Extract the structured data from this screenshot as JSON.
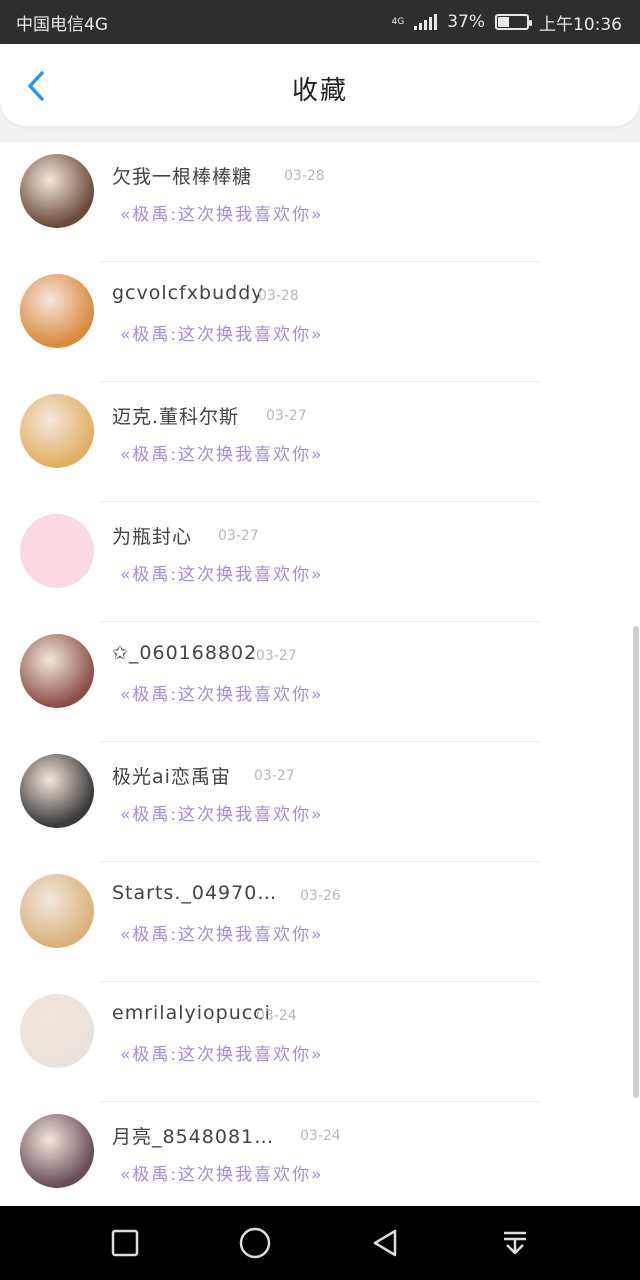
{
  "status_bar": {
    "carrier": "中国电信4G",
    "network_type": "4G",
    "battery_percent": "37%",
    "battery_level": 0.37,
    "time": "上午10:36"
  },
  "header": {
    "title": "收藏",
    "back_icon": "chevron-left-icon",
    "accent_color": "#2196f3"
  },
  "favorites": [
    {
      "name": "欠我一根棒棒糖",
      "date": "03-28",
      "message": "«极禹:这次换我喜欢你»",
      "avatar_color": "#6b4a3a"
    },
    {
      "name": "gcvolcfxbuddy",
      "date": "03-28",
      "message": "«极禹:这次换我喜欢你»",
      "avatar_color": "#d98a3a"
    },
    {
      "name": "迈克.董科尔斯",
      "date": "03-27",
      "message": "«极禹:这次换我喜欢你»",
      "avatar_color": "#e0b060"
    },
    {
      "name": "为瓶封心",
      "date": "03-27",
      "message": "«极禹:这次换我喜欢你»",
      "avatar_color": "#fbd9e3"
    },
    {
      "name": "✩_060168802",
      "date": "03-27",
      "message": "«极禹:这次换我喜欢你»",
      "avatar_color": "#8a5048"
    },
    {
      "name": "极光ai恋禹宙",
      "date": "03-27",
      "message": "«极禹:这次换我喜欢你»",
      "avatar_color": "#3a3a3a"
    },
    {
      "name": "Starts._0497015…",
      "date": "03-26",
      "message": "«极禹:这次换我喜欢你»",
      "avatar_color": "#d8b27a"
    },
    {
      "name": "emrilalyiopucci",
      "date": "03-24",
      "message": "«极禹:这次换我喜欢你»",
      "avatar_color": "#e8e2dc"
    },
    {
      "name": "月亮_854808157…",
      "date": "03-24",
      "message": "«极禹:这次换我喜欢你»",
      "avatar_color": "#6a4c5a"
    }
  ],
  "message_color": "#a98bd6",
  "nav_bar": {
    "buttons": [
      "square-icon",
      "circle-home-icon",
      "triangle-back-icon",
      "notification-pull-down-icon"
    ]
  }
}
